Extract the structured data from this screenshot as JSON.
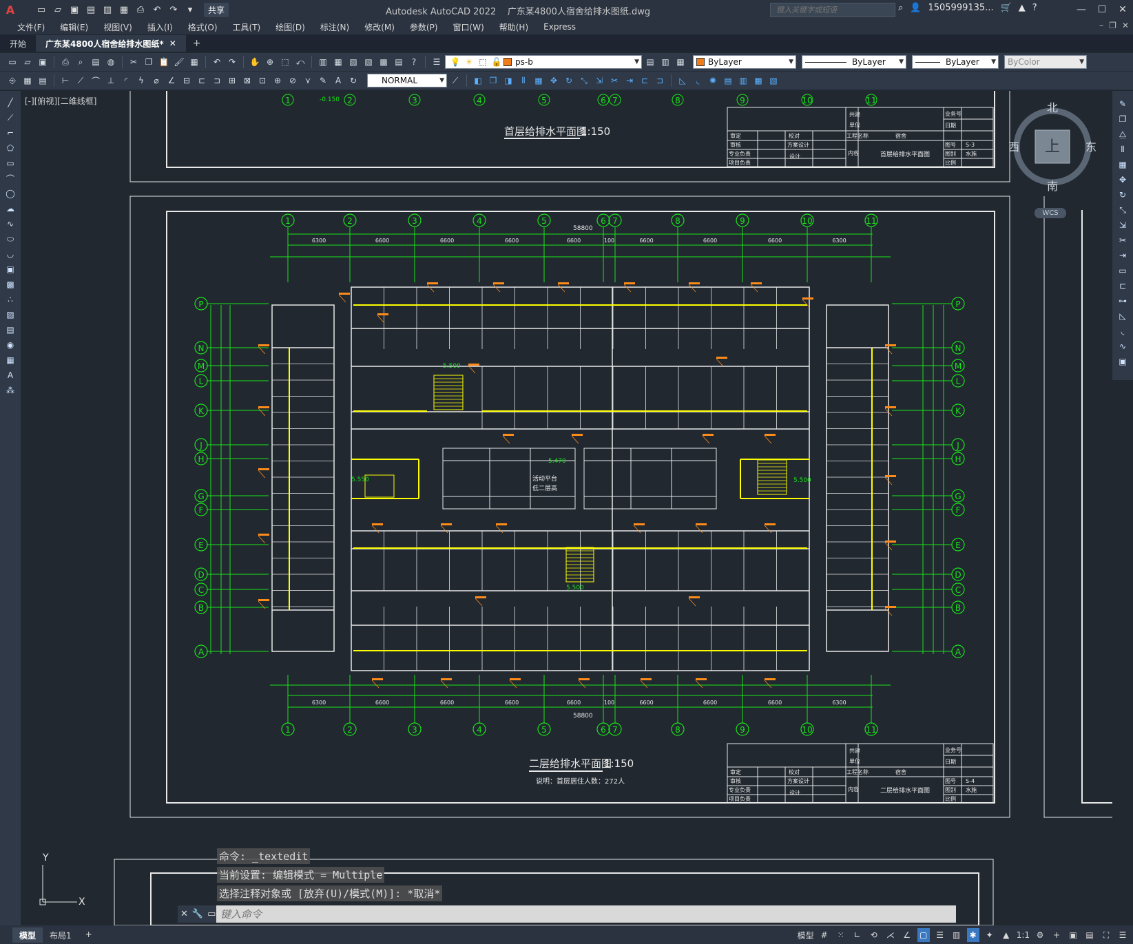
{
  "titlebar": {
    "app_title": "Autodesk AutoCAD 2022",
    "file_name": "广东某4800人宿舍给排水图纸.dwg",
    "share_label": "共享",
    "search_placeholder": "键入关键字或短语",
    "user": "1505999135..."
  },
  "menu": [
    "文件(F)",
    "编辑(E)",
    "视图(V)",
    "插入(I)",
    "格式(O)",
    "工具(T)",
    "绘图(D)",
    "标注(N)",
    "修改(M)",
    "参数(P)",
    "窗口(W)",
    "帮助(H)",
    "Express"
  ],
  "tabs": {
    "start": "开始",
    "doc": "广东某4800人宿舍给排水图纸*"
  },
  "toolbar": {
    "layer": "ps-b",
    "color": "ByLayer",
    "linetype": "ByLayer",
    "lineweight": "ByLayer",
    "plotstyle": "ByColor",
    "dimstyle": "NORMAL"
  },
  "viewport_label": "[-][俯视][二维线框]",
  "viewcube": {
    "north": "北",
    "south": "南",
    "east": "东",
    "west": "西",
    "top": "上",
    "wcs": "WCS"
  },
  "drawing": {
    "grid_cols": [
      "1",
      "2",
      "3",
      "4",
      "5",
      "6",
      "7",
      "8",
      "9",
      "10",
      "11"
    ],
    "grid_rows_left": [
      "P",
      "N",
      "M",
      "L",
      "K",
      "J",
      "H",
      "G",
      "F",
      "E",
      "D",
      "C",
      "B",
      "A"
    ],
    "total_width": "58800",
    "span_dims": [
      "6300",
      "6600",
      "6600",
      "6600",
      "6600",
      "100",
      "6600",
      "6600",
      "6600",
      "6300"
    ],
    "top_title": "首层给排水平面图",
    "top_scale": "1:150",
    "main_title": "二层给排水平面图",
    "main_scale": "1:150",
    "main_note": "说明：首层居住人数：272人",
    "platform_label": "活动平台",
    "platform_label2": "低二层高",
    "elev_1": "5.470",
    "elev_2": "5.500",
    "elev_3": "5.550",
    "top_elev": "-0.150",
    "title_block_top": {
      "project": "宿舍",
      "drawing_name": "首层给排水平面图",
      "drawing_no": "S-3",
      "discipline": "水施"
    },
    "title_block_main": {
      "project": "宿舍",
      "drawing_name": "二层给排水平面图",
      "drawing_no": "S-4",
      "discipline": "水施"
    },
    "tb_labels": {
      "coop": "共建",
      "unit": "单位",
      "business": "业务号",
      "date": "日期",
      "approve": "审定",
      "check": "校对",
      "review": "审核",
      "scheme": "方案设计",
      "spec": "专业负责",
      "design": "设计",
      "pm": "项目负责",
      "project_name": "工程名称",
      "content": "内容",
      "drawing_number": "图号",
      "category": "图别",
      "scale": "比例"
    }
  },
  "command": {
    "history": [
      "命令: _textedit",
      "当前设置: 编辑模式 = Multiple",
      "选择注释对象或 [放弃(U)/模式(M)]: *取消*"
    ],
    "placeholder": "键入命令"
  },
  "status": {
    "model_tab": "模型",
    "layout_tab": "布局1",
    "model_label": "模型",
    "scale": "1:1"
  },
  "colors": {
    "grid_green": "#19e619",
    "wall_white": "#e8e8e8",
    "pipe_yellow": "#ffff00",
    "label_orange": "#ff8c1a",
    "pipe_cyan": "#00e5ff"
  }
}
